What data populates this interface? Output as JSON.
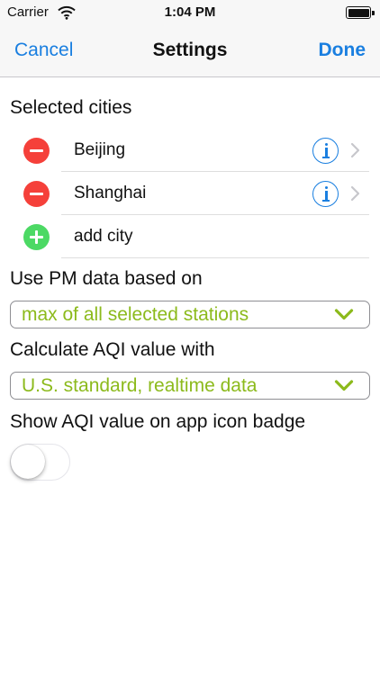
{
  "status_bar": {
    "carrier": "Carrier",
    "time": "1:04 PM"
  },
  "nav": {
    "cancel_label": "Cancel",
    "title": "Settings",
    "done_label": "Done"
  },
  "selected_cities": {
    "label": "Selected cities",
    "cities": [
      {
        "name": "Beijing"
      },
      {
        "name": "Shanghai"
      }
    ],
    "add_label": "add city"
  },
  "pm_data": {
    "label": "Use PM data based on",
    "selected": "max of all selected stations"
  },
  "aqi_calc": {
    "label": "Calculate AQI value with",
    "selected": "U.S. standard, realtime data"
  },
  "badge": {
    "label": "Show AQI value on app icon badge",
    "enabled": false
  },
  "colors": {
    "accent_blue": "#1a7fe0",
    "select_text_green": "#8cba1c",
    "remove_red": "#f5403a",
    "add_green": "#4cd964"
  },
  "icons": [
    "wifi-icon",
    "battery-icon",
    "remove-icon",
    "add-icon",
    "info-icon",
    "chevron-right-icon",
    "chevron-down-icon"
  ]
}
